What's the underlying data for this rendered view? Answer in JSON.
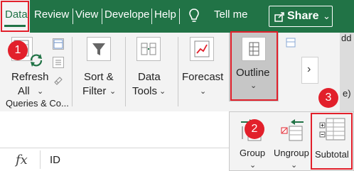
{
  "tabs": {
    "data": "Data",
    "review": "Review",
    "view": "View",
    "developer": "Develope",
    "help": "Help",
    "tell_me": "Tell me"
  },
  "share": {
    "label": "Share",
    "chevron": "⌄"
  },
  "groups": {
    "queries": {
      "refresh_label": "Refresh",
      "refresh_sub": "All",
      "group_caption": "Queries & Co..."
    },
    "sort_filter": {
      "line1": "Sort &",
      "line2": "Filter"
    },
    "data_tools": {
      "line1": "Data",
      "line2": "Tools"
    },
    "forecast": {
      "line1": "Forecast"
    },
    "outline": {
      "line1": "Outline"
    }
  },
  "chevron": "⌄",
  "more_arrow": "›",
  "right_edge_fragments": [
    "dd",
    "e)"
  ],
  "formula_bar": {
    "fx": "fx",
    "value": "ID"
  },
  "outline_menu": {
    "group": "Group",
    "ungroup": "Ungroup",
    "subtotal": "Subtotal"
  },
  "badges": [
    "1",
    "2",
    "3"
  ],
  "colors": {
    "excel_green": "#217346",
    "highlight_red": "#e2202b",
    "ribbon_bg": "#f3f3f3",
    "pressed_bg": "#c6c6c6"
  },
  "icons": [
    "lightbulb-icon",
    "refresh-all-icon",
    "sort-filter-icon",
    "data-tools-icon",
    "forecast-icon",
    "outline-icon",
    "group-icon",
    "ungroup-icon",
    "subtotal-icon"
  ]
}
